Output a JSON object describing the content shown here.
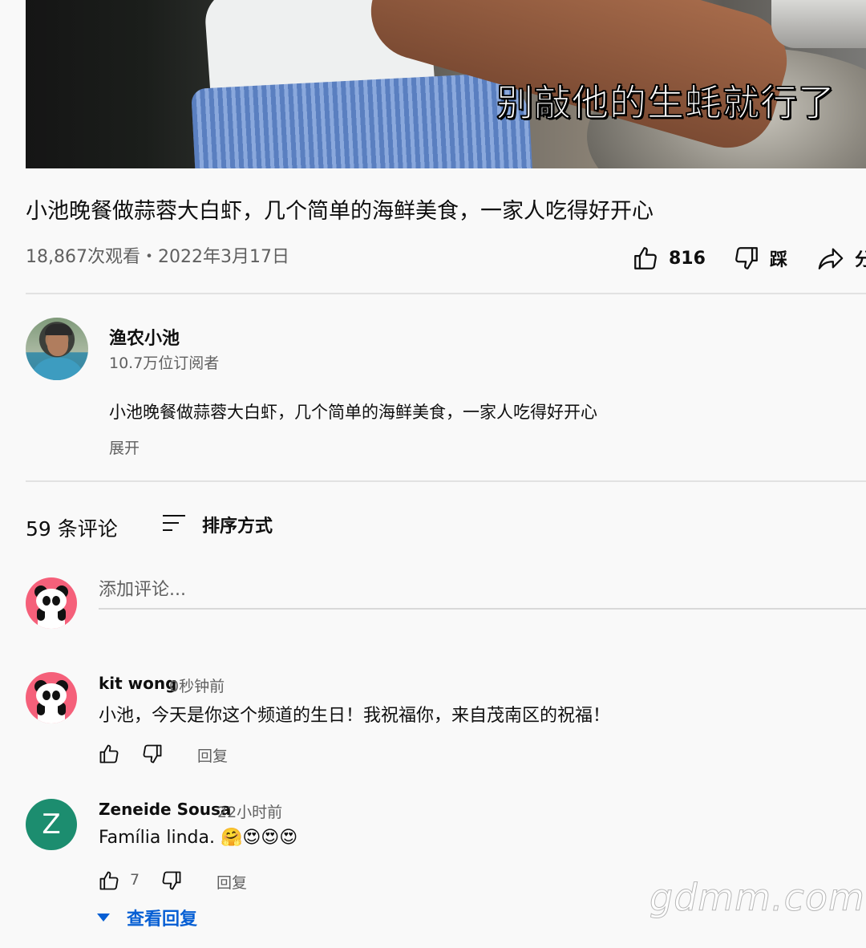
{
  "video": {
    "subtitle": "别敲他的生蚝就行了",
    "title": "小池晚餐做蒜蓉大白虾，几个简单的海鲜美食，一家人吃得好开心",
    "meta": "18,867次观看・2022年3月17日",
    "like_count": "816",
    "dislike_label": "踩",
    "share_label": "分"
  },
  "channel": {
    "name": "渔农小池",
    "subscribers": "10.7万位订阅者",
    "description": "小池晚餐做蒜蓉大白虾，几个简单的海鲜美食，一家人吃得好开心",
    "expand_label": "展开"
  },
  "comments_section": {
    "count_label": "59 条评论",
    "sort_label": "排序方式",
    "add_placeholder": "添加评论..."
  },
  "comments": [
    {
      "author": "kit wong",
      "time": "0秒钟前",
      "text": "小池，今天是你这个频道的生日！我祝福你，来自茂南区的祝福！",
      "likes": "",
      "reply_label": "回复"
    },
    {
      "author": "Zeneide Sousa",
      "avatar_letter": "Z",
      "time": "22小时前",
      "text": "Família linda. 🤗😍😍😍",
      "likes": "7",
      "reply_label": "回复",
      "view_replies_label": "查看回复"
    }
  ],
  "watermark": "gdmm.com",
  "colors": {
    "background": "#f9f9f9",
    "link_blue": "#065fd4",
    "avatar_green": "#1c8d6f",
    "avatar_pink": "#f5607a"
  }
}
